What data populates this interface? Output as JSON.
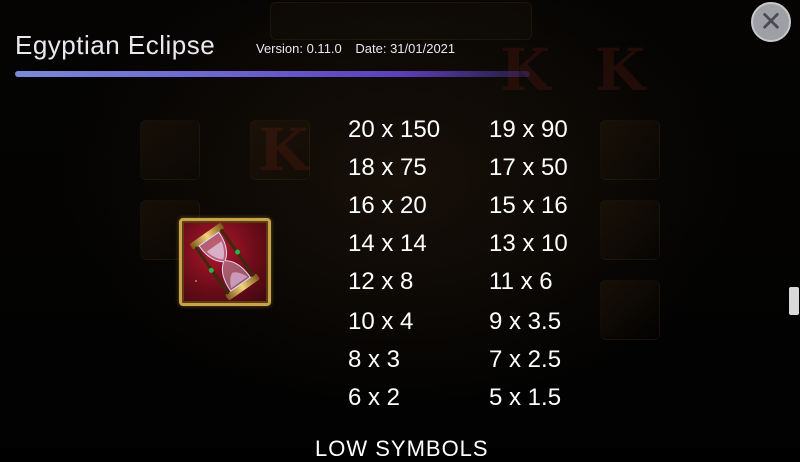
{
  "header": {
    "title": "Egyptian Eclipse",
    "version": "Version: 0.11.0",
    "date": "Date: 31/01/2021"
  },
  "close_label": "✕",
  "symbol": {
    "name": "hourglass-icon"
  },
  "paytable": {
    "left": [
      "20 x 150",
      "18 x 75",
      "16 x 20",
      "14 x 14",
      "12 x 8",
      "10 x 4",
      "8 x 3",
      "6 x 2"
    ],
    "right": [
      "19 x 90",
      "17 x 50",
      "15 x 16",
      "13 x 10",
      "11 x 6",
      "9 x 3.5",
      "7 x 2.5",
      "5 x 1.5"
    ]
  },
  "next_section": "LOW SYMBOLS",
  "colors": {
    "accent": "#6a5fcf",
    "close_bg": "#9ea0a6",
    "frame_gold": "#c9a24a"
  }
}
